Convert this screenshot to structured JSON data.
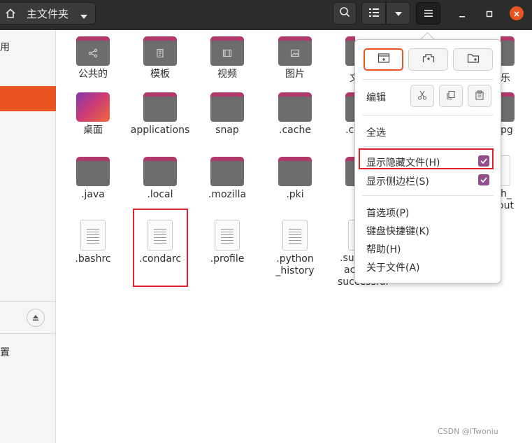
{
  "header": {
    "path_label": "主文件夹",
    "home_icon": "home-icon",
    "search_icon": "search-icon",
    "view_list_icon": "list-view-icon",
    "view_options_icon": "chevron-down-icon",
    "menu_icon": "hamburger-menu-icon",
    "minimize_icon": "minimize-icon",
    "maximize_icon": "maximize-icon",
    "close_icon": "close-icon",
    "colors": {
      "bar": "#2c2c2c",
      "close": "#e95420"
    }
  },
  "sidebar": {
    "top_label_fragment": "用",
    "bottom_label_fragment": "置",
    "eject_icon": "eject-icon",
    "selected_color": "#e95420"
  },
  "files": [
    {
      "name": "公共的",
      "type": "folder",
      "glyph": "share-icon"
    },
    {
      "name": "模板",
      "type": "folder",
      "glyph": "template-icon"
    },
    {
      "name": "视频",
      "type": "folder",
      "glyph": "video-icon"
    },
    {
      "name": "图片",
      "type": "folder",
      "glyph": "picture-icon"
    },
    {
      "name": "桌面",
      "type": "desktop"
    },
    {
      "name": "applications",
      "type": "folder"
    },
    {
      "name": "snap",
      "type": "folder"
    },
    {
      "name": ".cache",
      "type": "folder"
    },
    {
      "name": ".java",
      "type": "folder"
    },
    {
      "name": ".local",
      "type": "folder"
    },
    {
      "name": ".mozilla",
      "type": "folder"
    },
    {
      "name": ".pki",
      "type": "folder"
    },
    {
      "name": ".bashrc",
      "type": "document"
    },
    {
      "name": ".condarc",
      "type": "document"
    },
    {
      "name": ".profile",
      "type": "document"
    },
    {
      "name": ".python_history",
      "type": "document"
    }
  ],
  "partial_items": {
    "col5_row1": "文",
    "col5_row2": ".c",
    "col5_row4_line1": ".su",
    "col5_row4_line2": "ac",
    "col5_row4_line3": "successful",
    "col7_row1": "乐",
    "col7_row2": "pg",
    "col7_row3_line1": "h_",
    "col7_row3_line2": "out"
  },
  "menu": {
    "new_window_icon": "new-window-icon",
    "new_tab_icon": "new-tab-icon",
    "new_folder_icon": "new-folder-icon",
    "edit_label": "编辑",
    "cut_icon": "cut-icon",
    "copy_icon": "copy-icon",
    "paste_icon": "paste-icon",
    "select_all": "全选",
    "show_hidden": "显示隐藏文件(H)",
    "show_hidden_checked": true,
    "show_sidebar": "显示侧边栏(S)",
    "show_sidebar_checked": true,
    "preferences": "首选项(P)",
    "shortcuts": "键盘快捷键(K)",
    "help": "帮助(H)",
    "about": "关于文件(A)",
    "check_color": "#924d8b",
    "active_border_color": "#e95420"
  },
  "watermark": "CSDN @ITwoniu"
}
